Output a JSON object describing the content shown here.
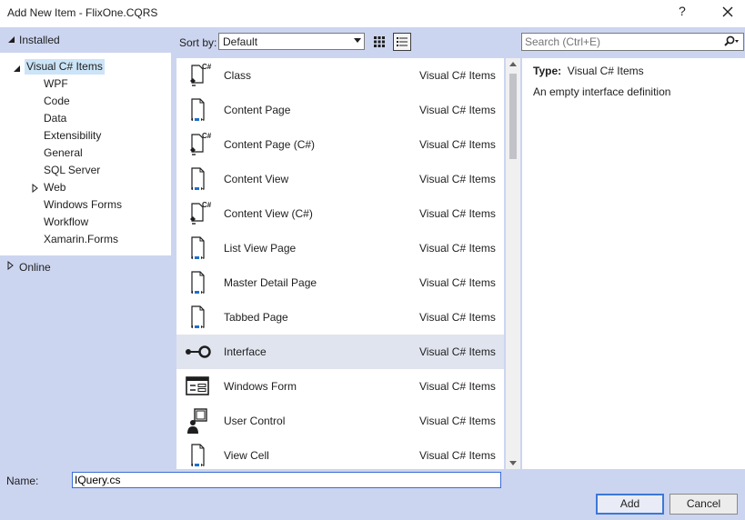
{
  "window": {
    "title": "Add New Item - FlixOne.CQRS",
    "help_label": "?",
    "close_icon": "close-icon"
  },
  "left_panel": {
    "installed_label": "Installed",
    "tree": {
      "root": "Visual C# Items",
      "children": [
        "WPF",
        "Code",
        "Data",
        "Extensibility",
        "General",
        "SQL Server",
        "Web",
        "Windows Forms",
        "Workflow",
        "Xamarin.Forms"
      ]
    },
    "online_label": "Online"
  },
  "toolbar": {
    "sort_label": "Sort by:",
    "sort_value": "Default",
    "view_icons": [
      "medium-icons-view-icon",
      "list-view-icon"
    ],
    "search_placeholder": "Search (Ctrl+E)"
  },
  "items": [
    {
      "name": "Class",
      "category": "Visual C# Items",
      "icon": "csharp-class-icon"
    },
    {
      "name": "Content Page",
      "category": "Visual C# Items",
      "icon": "xaml-page-icon"
    },
    {
      "name": "Content Page (C#)",
      "category": "Visual C# Items",
      "icon": "csharp-page-icon"
    },
    {
      "name": "Content View",
      "category": "Visual C# Items",
      "icon": "xaml-page-icon"
    },
    {
      "name": "Content View (C#)",
      "category": "Visual C# Items",
      "icon": "csharp-page-icon"
    },
    {
      "name": "List View Page",
      "category": "Visual C# Items",
      "icon": "xaml-page-icon"
    },
    {
      "name": "Master Detail Page",
      "category": "Visual C# Items",
      "icon": "xaml-page-icon"
    },
    {
      "name": "Tabbed Page",
      "category": "Visual C# Items",
      "icon": "xaml-page-icon"
    },
    {
      "name": "Interface",
      "category": "Visual C# Items",
      "icon": "interface-icon"
    },
    {
      "name": "Windows Form",
      "category": "Visual C# Items",
      "icon": "windows-form-icon"
    },
    {
      "name": "User Control",
      "category": "Visual C# Items",
      "icon": "user-control-icon"
    },
    {
      "name": "View Cell",
      "category": "Visual C# Items",
      "icon": "xaml-page-icon"
    }
  ],
  "selected_item": "Interface",
  "details": {
    "type_label": "Type:",
    "type_value": "Visual C# Items",
    "description": "An empty interface definition"
  },
  "footer": {
    "name_label": "Name:",
    "name_value": "IQuery.cs",
    "add_label": "Add",
    "cancel_label": "Cancel"
  },
  "colors": {
    "selection": "#cce4f7",
    "panel_bg": "#ccd5f0",
    "selected_row": "#e0e4ee",
    "accent": "#3c78d8"
  }
}
